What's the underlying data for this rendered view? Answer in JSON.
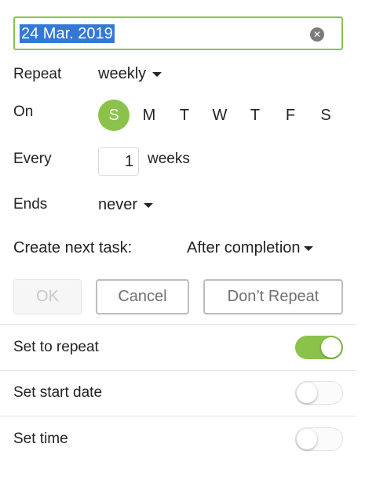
{
  "date_field": {
    "value": "24 Mar. 2019",
    "clear_icon": "clear-circle-icon"
  },
  "repeat": {
    "label": "Repeat",
    "value": "weekly"
  },
  "on": {
    "label": "On",
    "days": [
      "S",
      "M",
      "T",
      "W",
      "T",
      "F",
      "S"
    ],
    "selected_index": 0
  },
  "every": {
    "label": "Every",
    "value": "1",
    "unit": "weeks"
  },
  "ends": {
    "label": "Ends",
    "value": "never"
  },
  "next_task": {
    "label": "Create next task:",
    "value": "After completion"
  },
  "buttons": {
    "ok": "OK",
    "cancel": "Cancel",
    "dont_repeat": "Don’t Repeat"
  },
  "toggles": {
    "repeat": {
      "label": "Set to repeat",
      "on": true
    },
    "start_date": {
      "label": "Set start date",
      "on": false
    },
    "time": {
      "label": "Set time",
      "on": false
    }
  },
  "colors": {
    "accent": "#8bc34a",
    "selection": "#3478d6"
  }
}
